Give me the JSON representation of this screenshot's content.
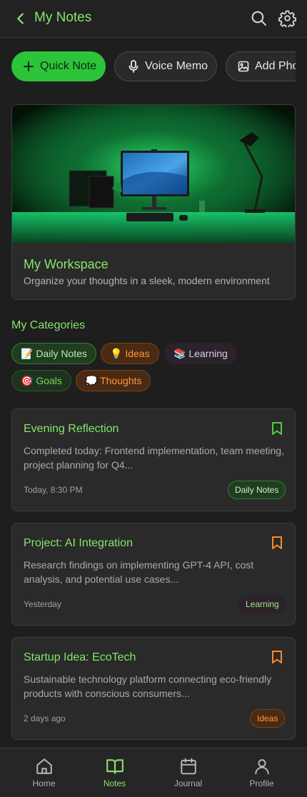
{
  "header": {
    "title": "My Notes",
    "back_icon": "chevron-left-icon",
    "search_icon": "search-icon",
    "settings_icon": "gear-icon"
  },
  "quick_actions": [
    {
      "label": "Quick Note",
      "icon": "plus-icon"
    },
    {
      "label": "Voice Memo",
      "icon": "microphone-icon"
    },
    {
      "label": "Add Photo",
      "icon": "image-icon"
    }
  ],
  "hero": {
    "title": "My Workspace",
    "subtitle": "Organize your thoughts in a sleek, modern environment"
  },
  "categories": {
    "title": "My Categories",
    "items": [
      {
        "label": "📝 Daily Notes"
      },
      {
        "label": "💡 Ideas"
      },
      {
        "label": "📚 Learning"
      },
      {
        "label": "🎯 Goals"
      },
      {
        "label": "💭 Thoughts"
      }
    ]
  },
  "notes": [
    {
      "title": "Evening Reflection",
      "body": "Completed today: Frontend implementation, team meeting, project planning for Q4...",
      "time": "Today, 8:30 PM",
      "tag": "Daily Notes",
      "bookmark_color": "#4ccf3e"
    },
    {
      "title": "Project: AI Integration",
      "body": "Research findings on implementing GPT-4 API, cost analysis, and potential use cases...",
      "time": "Yesterday",
      "tag": "Learning",
      "bookmark_color": "#ff8a2a"
    },
    {
      "title": "Startup Idea: EcoTech",
      "body": "Sustainable technology platform connecting eco-friendly products with conscious consumers...",
      "time": "2 days ago",
      "tag": "Ideas",
      "bookmark_color": "#ff8a2a"
    }
  ],
  "bottom_nav": [
    {
      "label": "Home",
      "icon": "home-icon",
      "active": false
    },
    {
      "label": "Notes",
      "icon": "book-open-icon",
      "active": true
    },
    {
      "label": "Journal",
      "icon": "calendar-icon",
      "active": false
    },
    {
      "label": "Profile",
      "icon": "user-icon",
      "active": false
    }
  ],
  "colors": {
    "accent": "#86e56b",
    "primary_button": "#2cc43a",
    "orange": "#ff8a2a",
    "background": "#1e1e1e",
    "card": "#2a2a2a"
  }
}
